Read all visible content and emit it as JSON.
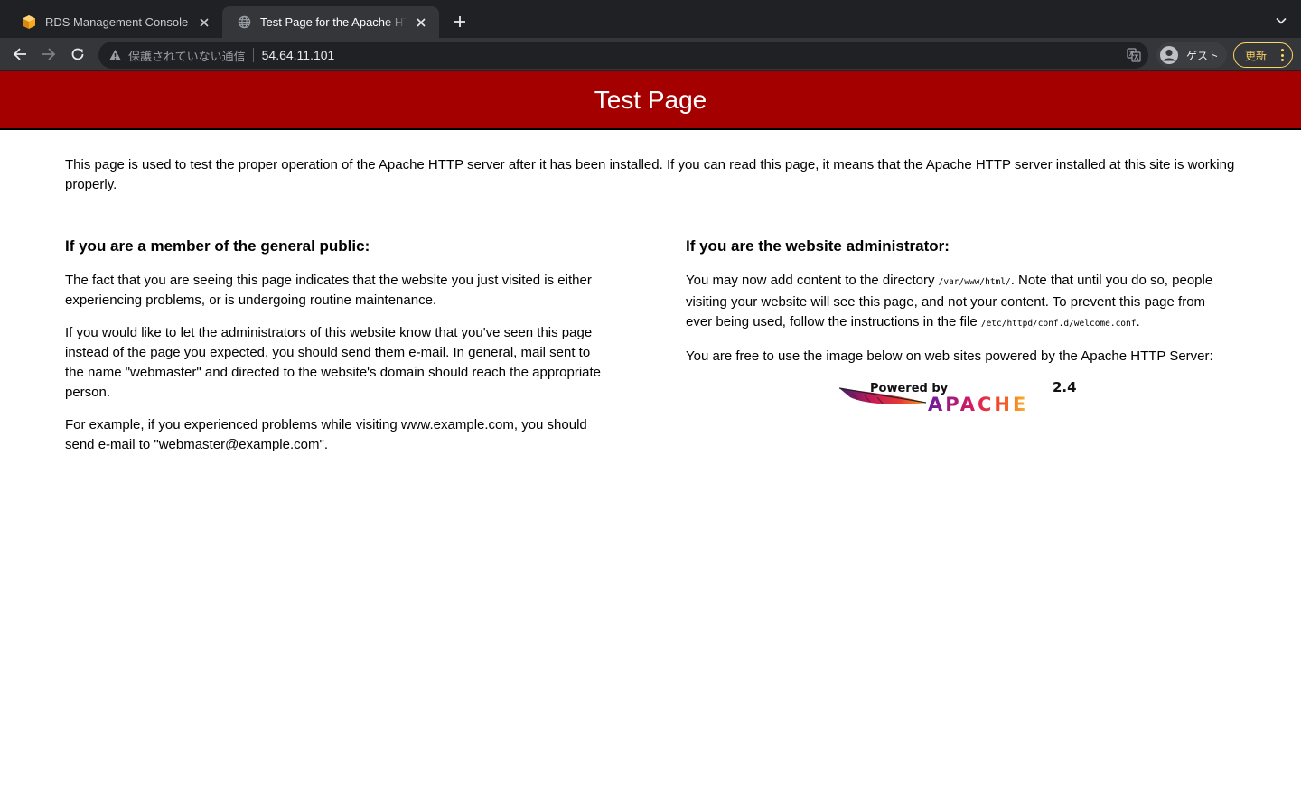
{
  "browser": {
    "tabs": [
      {
        "title": "RDS Management Console",
        "active": false,
        "icon": "aws-icon"
      },
      {
        "title": "Test Page for the Apache HTTP Server",
        "active": true,
        "icon": "globe-icon"
      }
    ],
    "omnibox": {
      "security_text": "保護されていない通信",
      "url": "54.64.11.101"
    },
    "profile_label": "ゲスト",
    "update_label": "更新",
    "colors": {
      "tabstrip": "#202124",
      "toolbar": "#35363a",
      "update": "#fdd663"
    }
  },
  "page": {
    "title": "Test Page",
    "intro": "This page is used to test the proper operation of the Apache HTTP server after it has been installed. If you can read this page, it means that the Apache HTTP server installed at this site is working properly.",
    "public": {
      "heading": "If you are a member of the general public:",
      "p1": "The fact that you are seeing this page indicates that the website you just visited is either experiencing problems, or is undergoing routine maintenance.",
      "p2": "If you would like to let the administrators of this website know that you've seen this page instead of the page you expected, you should send them e-mail. In general, mail sent to the name \"webmaster\" and directed to the website's domain should reach the appropriate person.",
      "p3": "For example, if you experienced problems while visiting www.example.com, you should send e-mail to \"webmaster@example.com\"."
    },
    "admin": {
      "heading": "If you are the website administrator:",
      "p1_before": "You may now add content to the directory ",
      "p1_dir": "/var/www/html/",
      "p1_middle": ". Note that until you do so, people visiting your website will see this page, and not your content. To prevent this page from ever being used, follow the instructions in the file ",
      "p1_file": "/etc/httpd/conf.d/welcome.conf",
      "p1_after": ".",
      "p2": "You are free to use the image below on web sites powered by the Apache HTTP Server:"
    },
    "badge": {
      "powered_by": "Powered by",
      "version": "2.4",
      "brand": "APACHE"
    },
    "colors": {
      "header": "#a50000"
    }
  }
}
